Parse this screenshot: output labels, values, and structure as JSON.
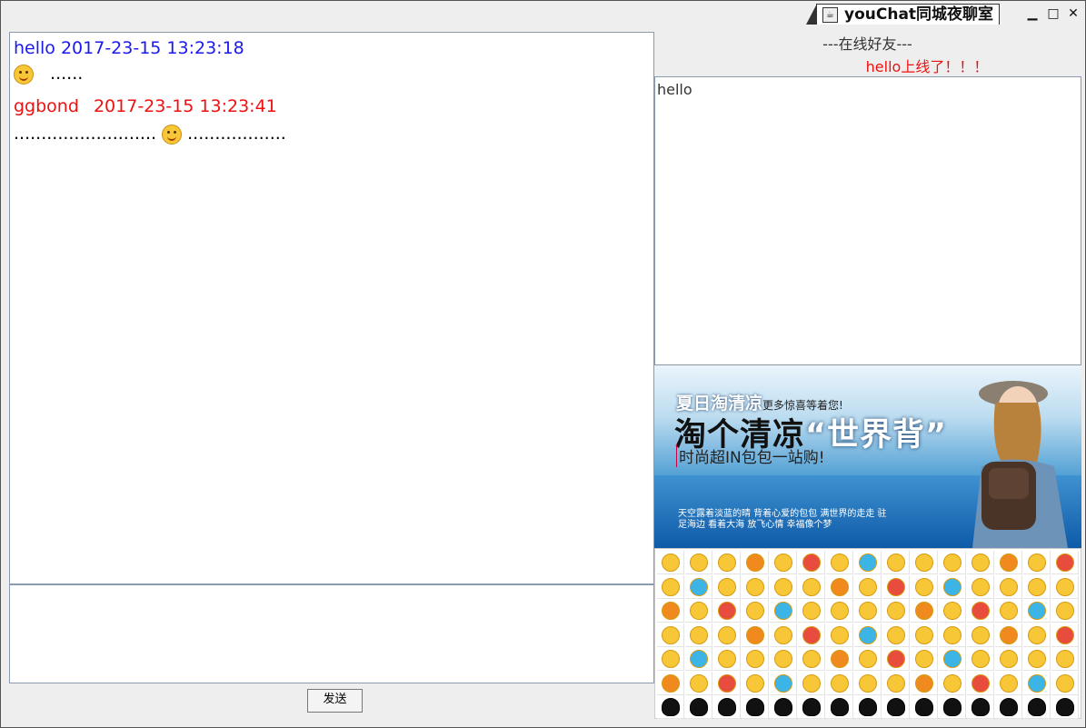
{
  "window": {
    "title": "youChat同城夜聊室",
    "minimize_icon": "minimize-icon",
    "maximize_icon": "maximize-icon",
    "close_icon": "close-icon"
  },
  "chat": {
    "messages": [
      {
        "sender": "hello",
        "time": "2017-23-15 13:23:18",
        "color": "#1a1aee",
        "body": "......",
        "emoji": "smile-emoji"
      },
      {
        "sender": "ggbond",
        "time": "2017-23-15 13:23:41",
        "color": "#ee1111",
        "body_before": "..........................",
        "body_after": "..................",
        "emoji": "shh-emoji"
      }
    ]
  },
  "input": {
    "value": ""
  },
  "send_button": {
    "label": "发送"
  },
  "online": {
    "header": "---在线好友---",
    "notice": "hello上线了！！！",
    "friends": [
      "hello"
    ]
  },
  "ad": {
    "line1": "夏日淘清凉",
    "line1_small": "更多惊喜等着您!",
    "line2_a": "淘个清凉",
    "line2_b": "“世界背”",
    "line3": "时尚超IN包包一站购!",
    "poem": "天空露着淡蓝的晴  背着心爱的包包 满世界的走走  驻足海边  看着大海  放飞心情 幸福像个梦"
  },
  "emoji_panel": {
    "rows": 7,
    "cols": 15,
    "icon": "emoji-icon"
  },
  "colors": {
    "sender_self": "#1a1aee",
    "sender_other": "#ee1111",
    "notice": "#ee1111"
  }
}
